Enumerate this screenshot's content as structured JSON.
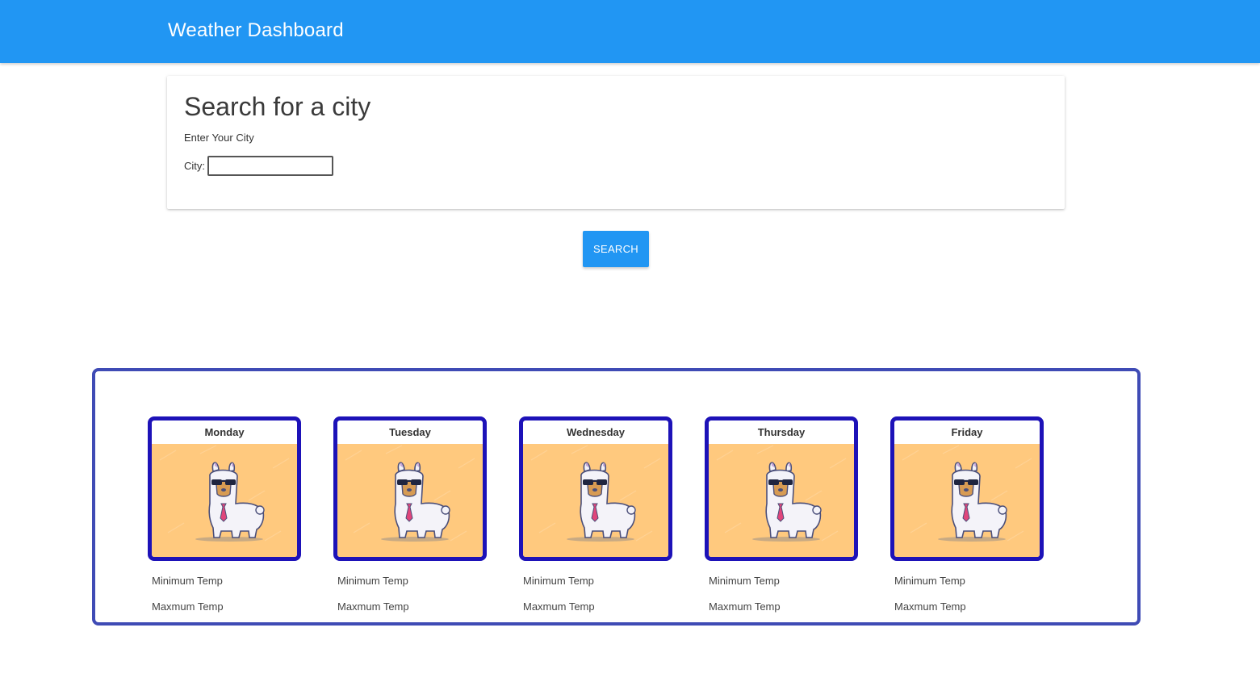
{
  "navbar": {
    "title": "Weather Dashboard"
  },
  "search": {
    "heading": "Search for a city",
    "subheading": "Enter Your City",
    "city_label": "City:",
    "city_value": "",
    "button_label": "Search"
  },
  "forecast": {
    "days": [
      {
        "name": "Monday",
        "min_label": "Minimum Temp",
        "max_label": "Maxmum Temp",
        "image": "llama-with-sunglasses-and-tie"
      },
      {
        "name": "Tuesday",
        "min_label": "Minimum Temp",
        "max_label": "Maxmum Temp",
        "image": "llama-with-sunglasses-and-tie"
      },
      {
        "name": "Wednesday",
        "min_label": "Minimum Temp",
        "max_label": "Maxmum Temp",
        "image": "llama-with-sunglasses-and-tie"
      },
      {
        "name": "Thursday",
        "min_label": "Minimum Temp",
        "max_label": "Maxmum Temp",
        "image": "llama-with-sunglasses-and-tie"
      },
      {
        "name": "Friday",
        "min_label": "Minimum Temp",
        "max_label": "Maxmum Temp",
        "image": "llama-with-sunglasses-and-tie"
      }
    ]
  },
  "colors": {
    "navbar": "#2196f3",
    "button": "#2196f3",
    "forecast_border": "#3f4bb5",
    "day_border": "#1d12b8",
    "art_background": "#ffc97e"
  }
}
